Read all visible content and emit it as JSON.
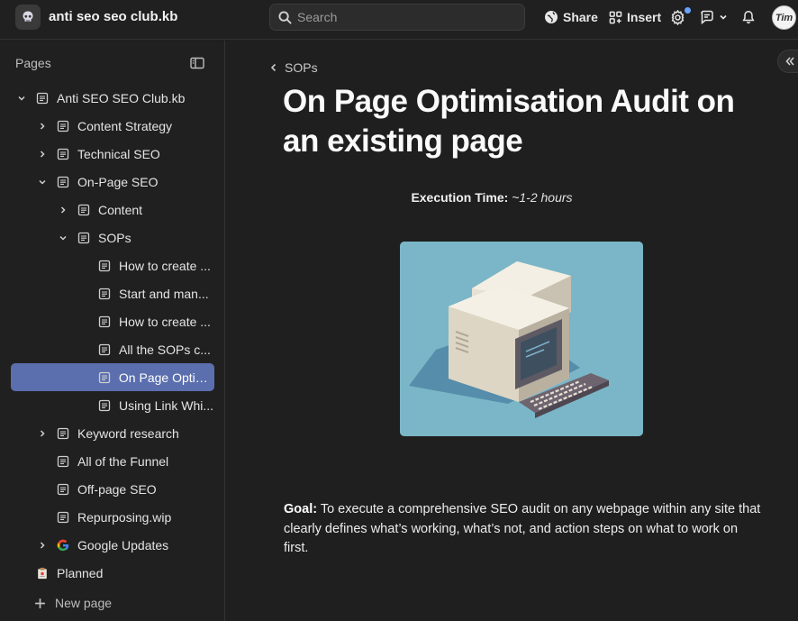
{
  "workspace": {
    "name": "anti seo seo club.kb",
    "logo_icon": "skull-icon"
  },
  "search": {
    "placeholder": "Search"
  },
  "toolbar": {
    "share_label": "Share",
    "insert_label": "Insert"
  },
  "user": {
    "avatar_text": "Tim"
  },
  "sidebar": {
    "heading": "Pages",
    "items": [
      {
        "label": "Anti SEO SEO Club.kb",
        "level": 0,
        "chevron": "down",
        "icon": "page-icon"
      },
      {
        "label": "Content Strategy",
        "level": 1,
        "chevron": "right",
        "icon": "page-icon"
      },
      {
        "label": "Technical SEO",
        "level": 1,
        "chevron": "right",
        "icon": "page-icon"
      },
      {
        "label": "On-Page SEO",
        "level": 1,
        "chevron": "down",
        "icon": "page-icon"
      },
      {
        "label": "Content",
        "level": 2,
        "chevron": "right",
        "icon": "page-icon"
      },
      {
        "label": "SOPs",
        "level": 2,
        "chevron": "down",
        "icon": "page-icon"
      },
      {
        "label": "How to create ...",
        "level": 3,
        "chevron": "none",
        "icon": "page-icon"
      },
      {
        "label": "Start and man...",
        "level": 3,
        "chevron": "none",
        "icon": "page-icon"
      },
      {
        "label": "How to create ...",
        "level": 3,
        "chevron": "none",
        "icon": "page-icon"
      },
      {
        "label": "All the SOPs c...",
        "level": 3,
        "chevron": "none",
        "icon": "page-icon"
      },
      {
        "label": "On Page Optimis",
        "level": 3,
        "chevron": "none",
        "icon": "page-icon",
        "active": true
      },
      {
        "label": "Using Link Whi...",
        "level": 3,
        "chevron": "none",
        "icon": "page-icon"
      },
      {
        "label": "Keyword research",
        "level": 1,
        "chevron": "right",
        "icon": "page-icon"
      },
      {
        "label": "All of the Funnel",
        "level": 1,
        "chevron": "none",
        "icon": "page-icon"
      },
      {
        "label": "Off-page SEO",
        "level": 1,
        "chevron": "none",
        "icon": "page-icon"
      },
      {
        "label": "Repurposing.wip",
        "level": 1,
        "chevron": "none",
        "icon": "page-icon"
      },
      {
        "label": "Google Updates",
        "level": 1,
        "chevron": "right",
        "icon": "google-icon"
      },
      {
        "label": "Planned",
        "level": 0,
        "chevron": "none",
        "icon": "clipboard-icon"
      }
    ],
    "new_page_label": "New page"
  },
  "page": {
    "breadcrumb": "SOPs",
    "title": "On Page Optimisation Audit on an existing page",
    "execution_label": "Execution Time:",
    "execution_value": "~1-2 hours",
    "goal_label": "Goal:",
    "goal_text": "To execute a comprehensive SEO audit on any webpage within any site that clearly defines what’s working, what’s not, and action steps on what to work on first."
  },
  "colors": {
    "active_item": "#5b6fae",
    "hero_background": "#7ab6c7",
    "notification_dot": "#6aa3ff"
  }
}
